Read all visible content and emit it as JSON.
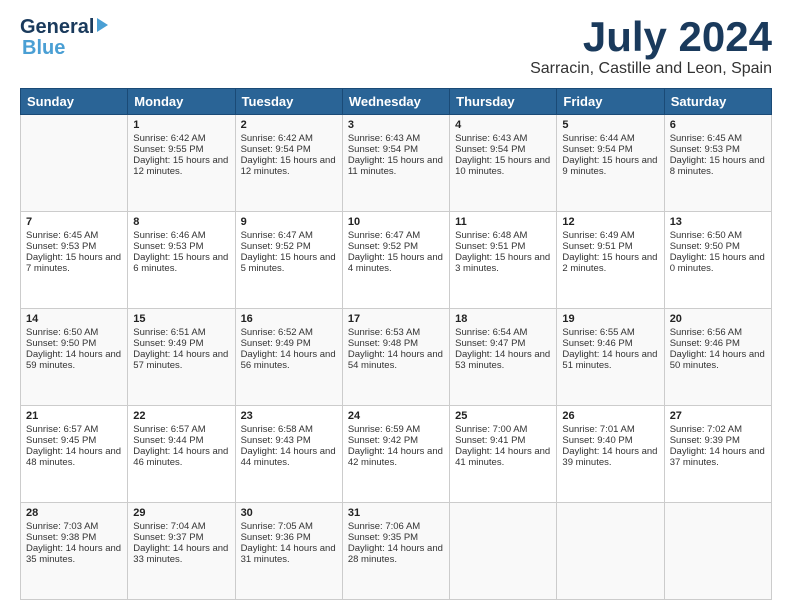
{
  "logo": {
    "line1": "General",
    "line2": "Blue",
    "arrow": "▶"
  },
  "title": "July 2024",
  "location": "Sarracin, Castille and Leon, Spain",
  "headers": [
    "Sunday",
    "Monday",
    "Tuesday",
    "Wednesday",
    "Thursday",
    "Friday",
    "Saturday"
  ],
  "weeks": [
    [
      {
        "day": "",
        "sunrise": "",
        "sunset": "",
        "daylight": ""
      },
      {
        "day": "1",
        "sunrise": "Sunrise: 6:42 AM",
        "sunset": "Sunset: 9:55 PM",
        "daylight": "Daylight: 15 hours and 12 minutes."
      },
      {
        "day": "2",
        "sunrise": "Sunrise: 6:42 AM",
        "sunset": "Sunset: 9:54 PM",
        "daylight": "Daylight: 15 hours and 12 minutes."
      },
      {
        "day": "3",
        "sunrise": "Sunrise: 6:43 AM",
        "sunset": "Sunset: 9:54 PM",
        "daylight": "Daylight: 15 hours and 11 minutes."
      },
      {
        "day": "4",
        "sunrise": "Sunrise: 6:43 AM",
        "sunset": "Sunset: 9:54 PM",
        "daylight": "Daylight: 15 hours and 10 minutes."
      },
      {
        "day": "5",
        "sunrise": "Sunrise: 6:44 AM",
        "sunset": "Sunset: 9:54 PM",
        "daylight": "Daylight: 15 hours and 9 minutes."
      },
      {
        "day": "6",
        "sunrise": "Sunrise: 6:45 AM",
        "sunset": "Sunset: 9:53 PM",
        "daylight": "Daylight: 15 hours and 8 minutes."
      }
    ],
    [
      {
        "day": "7",
        "sunrise": "Sunrise: 6:45 AM",
        "sunset": "Sunset: 9:53 PM",
        "daylight": "Daylight: 15 hours and 7 minutes."
      },
      {
        "day": "8",
        "sunrise": "Sunrise: 6:46 AM",
        "sunset": "Sunset: 9:53 PM",
        "daylight": "Daylight: 15 hours and 6 minutes."
      },
      {
        "day": "9",
        "sunrise": "Sunrise: 6:47 AM",
        "sunset": "Sunset: 9:52 PM",
        "daylight": "Daylight: 15 hours and 5 minutes."
      },
      {
        "day": "10",
        "sunrise": "Sunrise: 6:47 AM",
        "sunset": "Sunset: 9:52 PM",
        "daylight": "Daylight: 15 hours and 4 minutes."
      },
      {
        "day": "11",
        "sunrise": "Sunrise: 6:48 AM",
        "sunset": "Sunset: 9:51 PM",
        "daylight": "Daylight: 15 hours and 3 minutes."
      },
      {
        "day": "12",
        "sunrise": "Sunrise: 6:49 AM",
        "sunset": "Sunset: 9:51 PM",
        "daylight": "Daylight: 15 hours and 2 minutes."
      },
      {
        "day": "13",
        "sunrise": "Sunrise: 6:50 AM",
        "sunset": "Sunset: 9:50 PM",
        "daylight": "Daylight: 15 hours and 0 minutes."
      }
    ],
    [
      {
        "day": "14",
        "sunrise": "Sunrise: 6:50 AM",
        "sunset": "Sunset: 9:50 PM",
        "daylight": "Daylight: 14 hours and 59 minutes."
      },
      {
        "day": "15",
        "sunrise": "Sunrise: 6:51 AM",
        "sunset": "Sunset: 9:49 PM",
        "daylight": "Daylight: 14 hours and 57 minutes."
      },
      {
        "day": "16",
        "sunrise": "Sunrise: 6:52 AM",
        "sunset": "Sunset: 9:49 PM",
        "daylight": "Daylight: 14 hours and 56 minutes."
      },
      {
        "day": "17",
        "sunrise": "Sunrise: 6:53 AM",
        "sunset": "Sunset: 9:48 PM",
        "daylight": "Daylight: 14 hours and 54 minutes."
      },
      {
        "day": "18",
        "sunrise": "Sunrise: 6:54 AM",
        "sunset": "Sunset: 9:47 PM",
        "daylight": "Daylight: 14 hours and 53 minutes."
      },
      {
        "day": "19",
        "sunrise": "Sunrise: 6:55 AM",
        "sunset": "Sunset: 9:46 PM",
        "daylight": "Daylight: 14 hours and 51 minutes."
      },
      {
        "day": "20",
        "sunrise": "Sunrise: 6:56 AM",
        "sunset": "Sunset: 9:46 PM",
        "daylight": "Daylight: 14 hours and 50 minutes."
      }
    ],
    [
      {
        "day": "21",
        "sunrise": "Sunrise: 6:57 AM",
        "sunset": "Sunset: 9:45 PM",
        "daylight": "Daylight: 14 hours and 48 minutes."
      },
      {
        "day": "22",
        "sunrise": "Sunrise: 6:57 AM",
        "sunset": "Sunset: 9:44 PM",
        "daylight": "Daylight: 14 hours and 46 minutes."
      },
      {
        "day": "23",
        "sunrise": "Sunrise: 6:58 AM",
        "sunset": "Sunset: 9:43 PM",
        "daylight": "Daylight: 14 hours and 44 minutes."
      },
      {
        "day": "24",
        "sunrise": "Sunrise: 6:59 AM",
        "sunset": "Sunset: 9:42 PM",
        "daylight": "Daylight: 14 hours and 42 minutes."
      },
      {
        "day": "25",
        "sunrise": "Sunrise: 7:00 AM",
        "sunset": "Sunset: 9:41 PM",
        "daylight": "Daylight: 14 hours and 41 minutes."
      },
      {
        "day": "26",
        "sunrise": "Sunrise: 7:01 AM",
        "sunset": "Sunset: 9:40 PM",
        "daylight": "Daylight: 14 hours and 39 minutes."
      },
      {
        "day": "27",
        "sunrise": "Sunrise: 7:02 AM",
        "sunset": "Sunset: 9:39 PM",
        "daylight": "Daylight: 14 hours and 37 minutes."
      }
    ],
    [
      {
        "day": "28",
        "sunrise": "Sunrise: 7:03 AM",
        "sunset": "Sunset: 9:38 PM",
        "daylight": "Daylight: 14 hours and 35 minutes."
      },
      {
        "day": "29",
        "sunrise": "Sunrise: 7:04 AM",
        "sunset": "Sunset: 9:37 PM",
        "daylight": "Daylight: 14 hours and 33 minutes."
      },
      {
        "day": "30",
        "sunrise": "Sunrise: 7:05 AM",
        "sunset": "Sunset: 9:36 PM",
        "daylight": "Daylight: 14 hours and 31 minutes."
      },
      {
        "day": "31",
        "sunrise": "Sunrise: 7:06 AM",
        "sunset": "Sunset: 9:35 PM",
        "daylight": "Daylight: 14 hours and 28 minutes."
      },
      {
        "day": "",
        "sunrise": "",
        "sunset": "",
        "daylight": ""
      },
      {
        "day": "",
        "sunrise": "",
        "sunset": "",
        "daylight": ""
      },
      {
        "day": "",
        "sunrise": "",
        "sunset": "",
        "daylight": ""
      }
    ]
  ]
}
